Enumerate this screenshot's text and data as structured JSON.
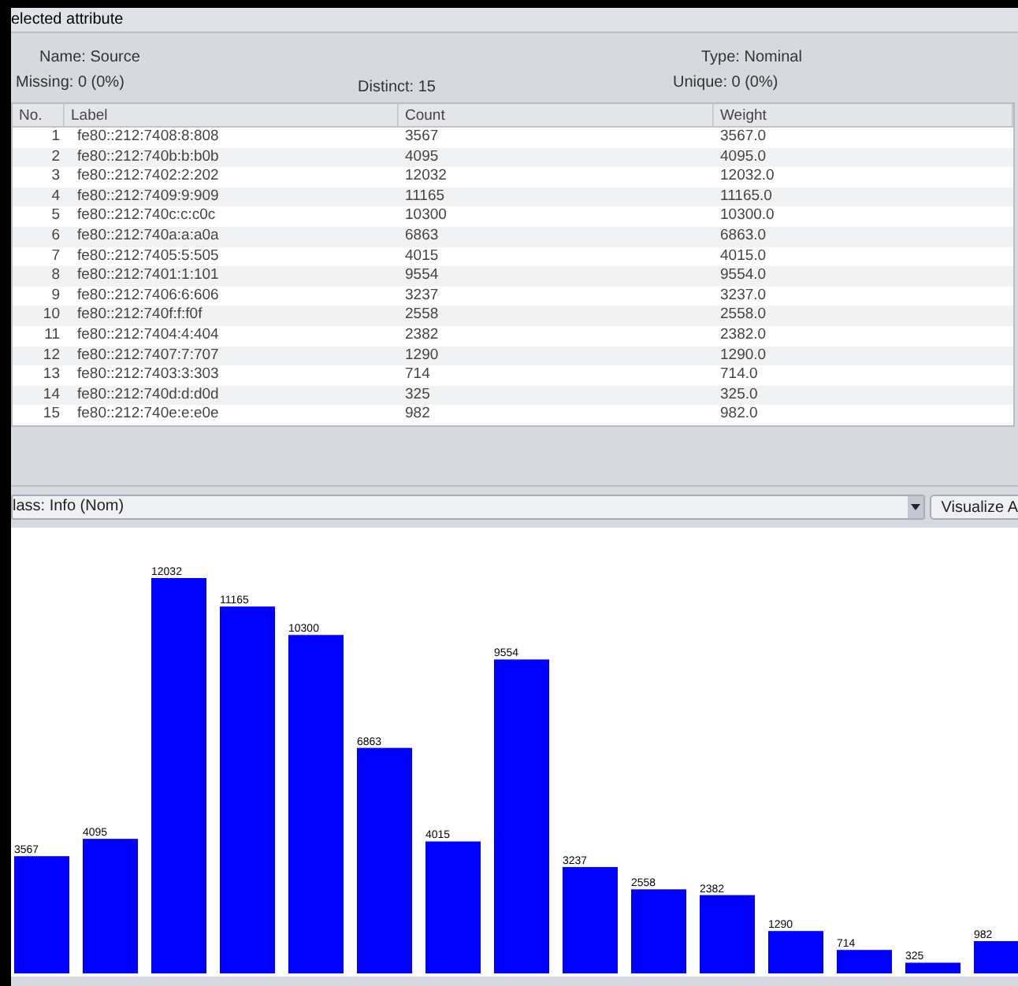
{
  "panel": {
    "title": "elected attribute"
  },
  "attribute": {
    "name_label": "Name:",
    "name": "Source",
    "missing": "Missing: 0 (0%)",
    "distinct": "Distinct: 15",
    "type_label": "Type:",
    "type": "Nominal",
    "unique": "Unique: 0 (0%)"
  },
  "table": {
    "columns": [
      "No.",
      "Label",
      "Count",
      "Weight"
    ],
    "rows": [
      [
        "1",
        "fe80::212:7408:8:808",
        "3567",
        "3567.0"
      ],
      [
        "2",
        "fe80::212:740b:b:b0b",
        "4095",
        "4095.0"
      ],
      [
        "3",
        "fe80::212:7402:2:202",
        "12032",
        "12032.0"
      ],
      [
        "4",
        "fe80::212:7409:9:909",
        "11165",
        "11165.0"
      ],
      [
        "5",
        "fe80::212:740c:c:c0c",
        "10300",
        "10300.0"
      ],
      [
        "6",
        "fe80::212:740a:a:a0a",
        "6863",
        "6863.0"
      ],
      [
        "7",
        "fe80::212:7405:5:505",
        "4015",
        "4015.0"
      ],
      [
        "8",
        "fe80::212:7401:1:101",
        "9554",
        "9554.0"
      ],
      [
        "9",
        "fe80::212:7406:6:606",
        "3237",
        "3237.0"
      ],
      [
        "10",
        "fe80::212:740f:f:f0f",
        "2558",
        "2558.0"
      ],
      [
        "11",
        "fe80::212:7404:4:404",
        "2382",
        "2382.0"
      ],
      [
        "12",
        "fe80::212:7407:7:707",
        "1290",
        "1290.0"
      ],
      [
        "13",
        "fe80::212:7403:3:303",
        "714",
        "714.0"
      ],
      [
        "14",
        "fe80::212:740d:d:d0d",
        "325",
        "325.0"
      ],
      [
        "15",
        "fe80::212:740e:e:e0e",
        "982",
        "982.0"
      ]
    ]
  },
  "class_select": {
    "value": "lass: Info (Nom)"
  },
  "visualize_button": {
    "label": "Visualize A"
  },
  "histogram": {
    "chart_data": {
      "type": "bar",
      "series": [
        {
          "color": "#0000ff",
          "values": [
            3567,
            4095,
            12032,
            11165,
            10300,
            6863,
            4015,
            9554,
            3237,
            2558,
            2382,
            1290,
            714,
            325,
            982
          ]
        }
      ],
      "data_labels": true
    }
  }
}
